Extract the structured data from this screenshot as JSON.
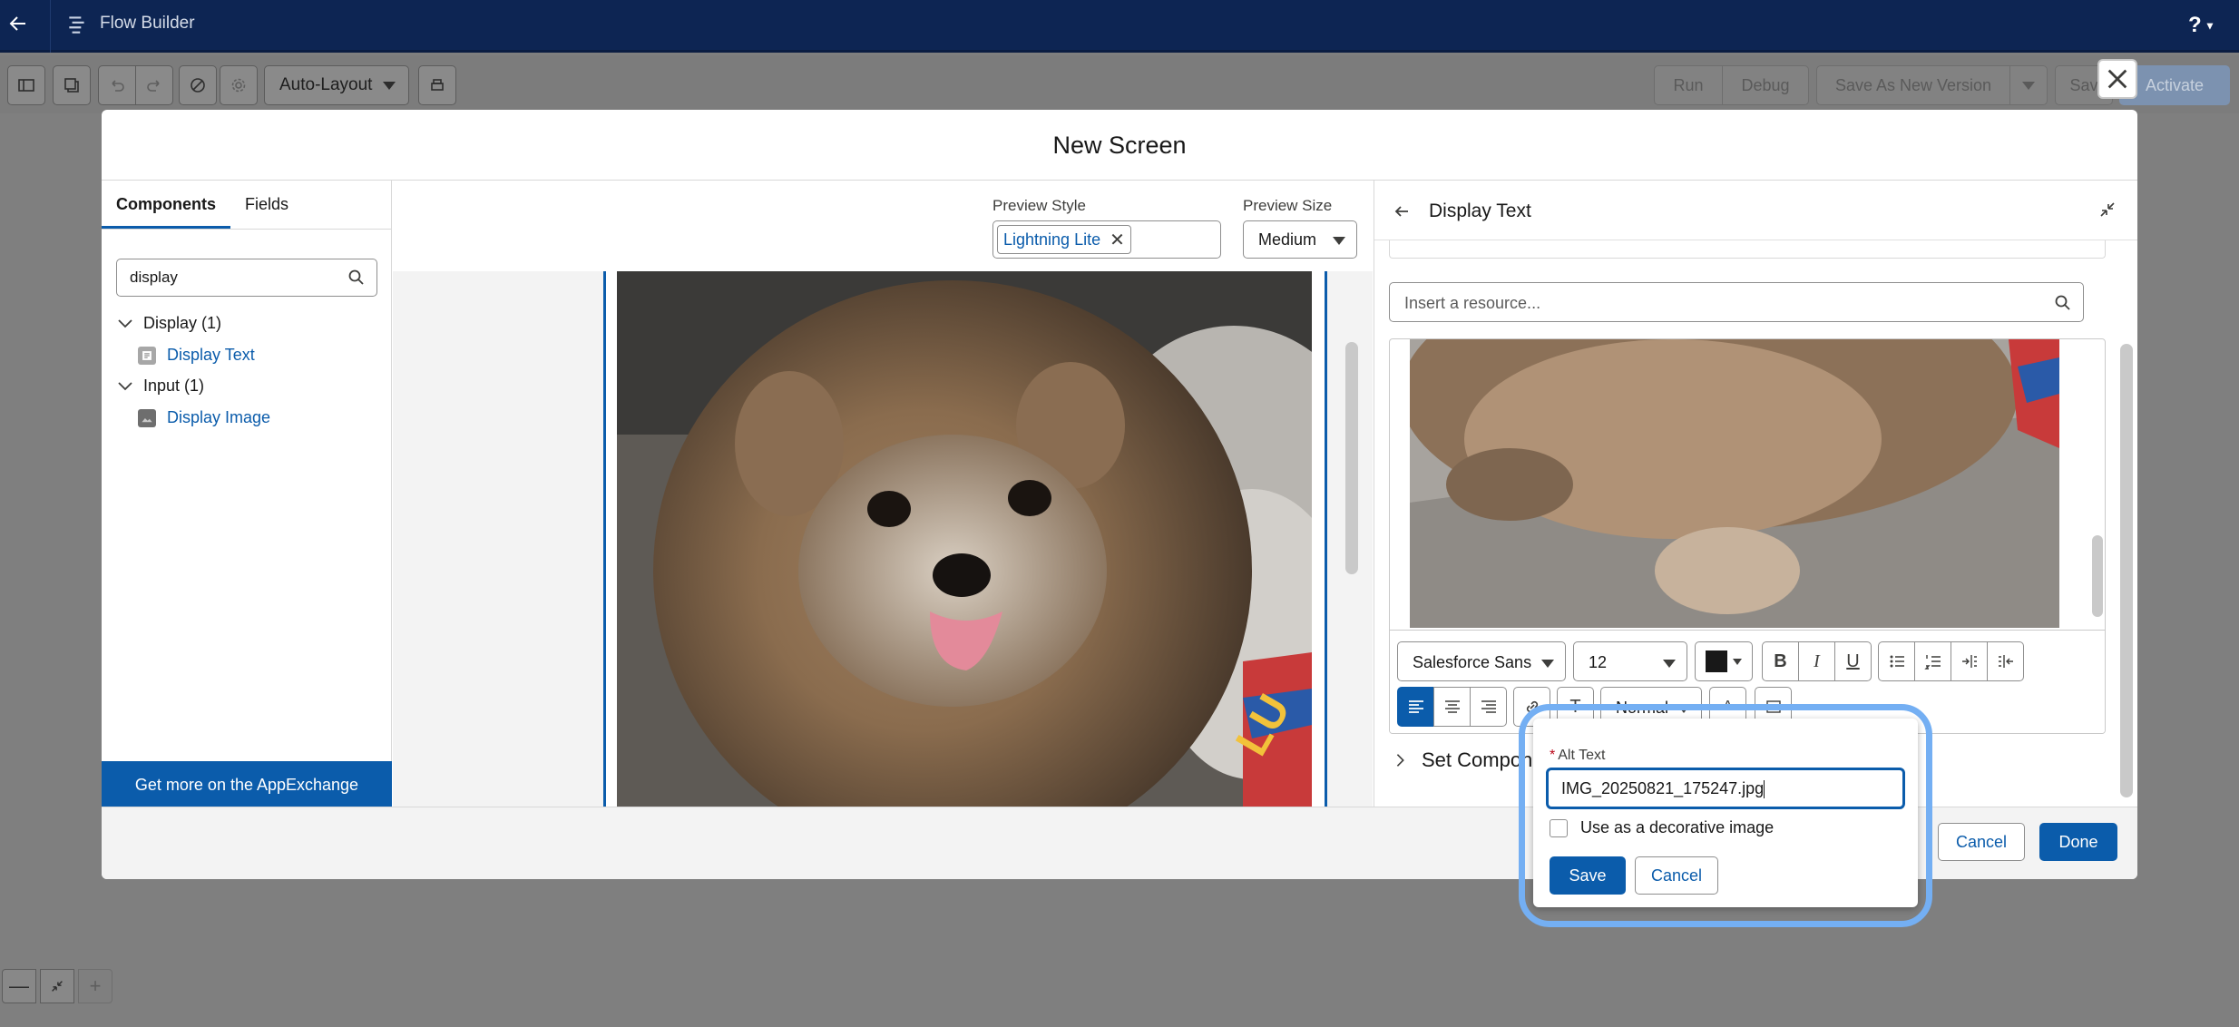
{
  "header": {
    "app_title": "Flow Builder",
    "help": "?"
  },
  "toolbar": {
    "layout_select": "Auto-Layout",
    "run": "Run",
    "debug": "Debug",
    "save_as_new_version": "Save As New Version",
    "save": "Sav",
    "activate": "Activate"
  },
  "modal": {
    "title": "New Screen",
    "tabs": [
      "Components",
      "Fields"
    ],
    "search_value": "display",
    "tree": [
      {
        "group": "Display (1)",
        "item": "Display Text"
      },
      {
        "group": "Input (1)",
        "item": "Display Image"
      }
    ],
    "appexchange": "Get more on the AppExchange",
    "preview_style_label": "Preview Style",
    "preview_style_value": "Lightning Lite",
    "preview_size_label": "Preview Size",
    "preview_size_value": "Medium",
    "properties_title": "Display Text",
    "resource_placeholder": "Insert a resource...",
    "editor": {
      "font_family": "Salesforce Sans",
      "font_size": "12",
      "text_style": "Normal"
    },
    "set_components_label": "Set Componen",
    "footer": {
      "cancel": "Cancel",
      "done": "Done"
    }
  },
  "alt_popover": {
    "label": "Alt Text",
    "value": "IMG_20250821_175247.jpg",
    "decorative_label": "Use as a decorative image",
    "save": "Save",
    "cancel": "Cancel"
  },
  "colors": {
    "brand": "#0b5cab",
    "header": "#0d2553",
    "highlight": "#74aff3"
  }
}
